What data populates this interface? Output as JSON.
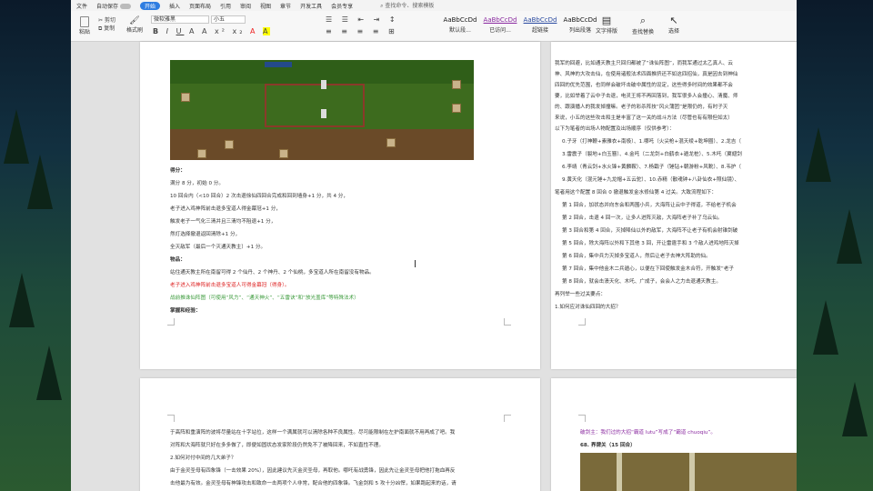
{
  "menubar": {
    "items": [
      "文件",
      "自动保存",
      "开始",
      "插入",
      "页面布局",
      "引用",
      "审阅",
      "视图",
      "章节",
      "开发工具",
      "会员专享"
    ],
    "search": "查找命令、搜索模板"
  },
  "ribbon": {
    "paste": "粘贴",
    "cut": "剪切",
    "copy": "复制",
    "format_painter": "格式刷",
    "font_name": "微软雅黑",
    "font_size": "小五",
    "styles": [
      {
        "sample": "AaBbCcDd",
        "label": "默认段..."
      },
      {
        "sample": "AaBbCcDd",
        "label": "已访问..."
      },
      {
        "sample": "AaBbCcDd",
        "label": "超链接"
      },
      {
        "sample": "AaBbCcDd",
        "label": "列出段落"
      }
    ],
    "text_tools": "文字排版",
    "find_replace": "查找替换",
    "select": "选择"
  },
  "page_left": {
    "lines": [
      {
        "t": "得分：",
        "cls": "bold"
      },
      {
        "t": "满分 8 分，初始 0 分。",
        "cls": ""
      },
      {
        "t": "10 回合内（<10 回合）2 次击退徐仙四回合完成和回到墙身+1 分，共 4 分，",
        "cls": ""
      },
      {
        "t": "老子进入鸡神阵前击退多宝道人得金幕冠+1 分，",
        "cls": ""
      },
      {
        "t": "触发老子一气化三清并且三清均不阻退+1 分，",
        "cls": ""
      },
      {
        "t": "然灯选择撤退返回清除+1 分，",
        "cls": ""
      },
      {
        "t": "全灭敌军（最后一个灭通天教主）+1 分。",
        "cls": ""
      },
      {
        "t": "物品：",
        "cls": "bold"
      },
      {
        "t": "站住通天教主所在南留可得 2 个仙丹、2 个神丹、2 个仙桃，多宝道人所在南留没有物品。",
        "cls": ""
      },
      {
        "t": "老子进入鸡神阵前击退多宝道人可得金幕冠（得身）。",
        "cls": "red"
      },
      {
        "t": "战前推诛仙阵图（可使用“风力”、“通天神火”、“五雷诀”和“放光盖库”等特殊法术）",
        "cls": "green"
      },
      {
        "t": "掌握和经验：",
        "cls": "bold"
      }
    ]
  },
  "page_right": {
    "lines": [
      "我军的回避，比如通天教主只回归都被了“诛仙阵图”，而我军通过太乙真人、云",
      "神、风神的大攻击仙，在使用诸般法术四面推挤还不如这四招仙，真是因去到神仙",
      "四回的优先范围，也同样会破坏击破中属性的设定，这些得多时间的效果都不会",
      "要，比如举着了云中子击退，电灵王将不再回落到，我军很多人会撞心、清魔、师",
      "的、跟演播人的我发掉撞嘛。老子的彩杀阵技“风火蒲团”是限仍的，有时子灭",
      "来说，小五的这些攻击和主是丰富了这一关的战斗方法（尽管也有有限但如太）",
      "以下为笔者的出场人物配置及出场顺序（仅供参考）：",
      "0.子牙（打神鞭+素雅衣+南极）、1.哪吒（火尖枪+混天绫+乾坤圈）、2.龙吉（",
      "3.雷震子（裂地+白玉簪）、4.金吒（二龙剑+白鹤衣+遁龙桩）、5.木吒（翼翅剑",
      "6.李靖（青云剑+水火锋+黄麟鞍）、7.杨戬子（锤钻+朝游粉+风靴）、8.韦护（",
      "9.黄天化（混元锤+九龙帽+五云驼）、10.赤精（散魂钟+八卦仙衣+照仙镜）、",
      "笔者用这个配置 8 回合 0 撤退触发金水修仙第 4 过关。大致流程如下：",
      "第 1 回合，加状态并向东会和两围小兵，大海阵让云中子得道，不给老子机会",
      "第 2 回合，击退 4 回一次，让多人进阵灭敌，大海阵老子补了乌云仙。",
      "第 3 回合和第 4 回合，灭掉降仙以外的敌军，大海阵不让老子有机会射锥剑破",
      "第 5 回合，除大海阵以外和下其他 3 回，开让雷霆手和 3 个敌人进鸡地阵灭掉",
      "第 6 回合，集中兵力灭掉多宝道人，然后让老子去神大阵助的仙。",
      "第 7 回合，集中他金木二兵遁心，以便在下回使触发金木合符，开触发“老子",
      "第 8 回合，就会击溃天化、木吒、广成子，会会人之力击退通天教主。",
      "再列举一些过关要点：",
      "1.如何应对诛仙四回的大招？"
    ]
  },
  "page_bottom_left": {
    "lines": [
      "于高阵和重演阵的波将尽量站在十字站位，这样一个满属就可以清除各种不良属性。尽可能限制在左护南面就不用再成了吧。我",
      "对阵和大海阵就只好在多多做了，即便如固状态发家阶段仍然免不了被降回来，不如直性不理。",
      "2.如何对付中间的几大弟子？",
      "由于金灵圣母有四象锋（一击效果 20%），因此建议先灭金灵圣母，再取他。哪吒有战勇锋，因此先让金灵圣母把他打拖血再反",
      "击他最为有效。金灵圣母有神锋攻击和致命一击两项个人非常，配合他的四象锋。飞金剑和 5 攻十分凶悍，如果跑起来的话，请"
    ]
  },
  "page_bottom_right": {
    "line1": "破剑主：我们过的大招“霸道 lutu”写成了“霸道 chuoqiu”。",
    "line2": "68. 界牌关（15 回合）"
  },
  "colors": {
    "accent": "#2f7de1",
    "green": "#3a9a3a",
    "red": "#dd2222",
    "purple": "#8a2aa0"
  }
}
